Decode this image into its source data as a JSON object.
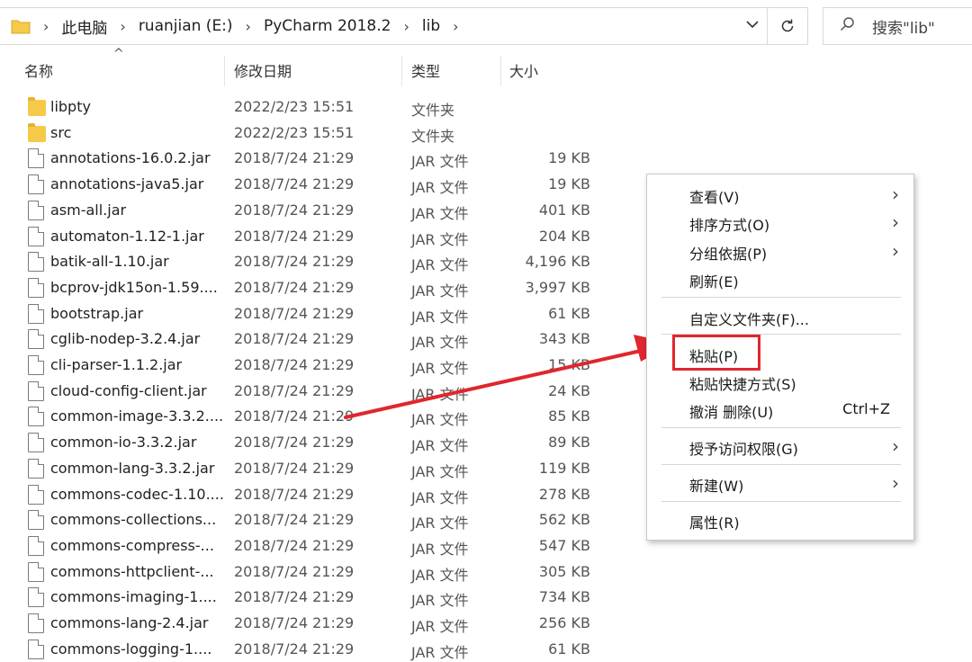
{
  "address": {
    "crumbs": [
      "此电脑",
      "ruanjian (E:)",
      "PyCharm 2018.2",
      "lib"
    ]
  },
  "search": {
    "placeholder": "搜索\"lib\""
  },
  "columns": {
    "name": "名称",
    "date": "修改日期",
    "type": "类型",
    "size": "大小"
  },
  "files": [
    {
      "name": "libpty",
      "date": "2022/2/23 15:51",
      "type": "文件夹",
      "size": "",
      "kind": "folder"
    },
    {
      "name": "src",
      "date": "2022/2/23 15:51",
      "type": "文件夹",
      "size": "",
      "kind": "folder"
    },
    {
      "name": "annotations-16.0.2.jar",
      "date": "2018/7/24 21:29",
      "type": "JAR 文件",
      "size": "19 KB",
      "kind": "file"
    },
    {
      "name": "annotations-java5.jar",
      "date": "2018/7/24 21:29",
      "type": "JAR 文件",
      "size": "19 KB",
      "kind": "file"
    },
    {
      "name": "asm-all.jar",
      "date": "2018/7/24 21:29",
      "type": "JAR 文件",
      "size": "401 KB",
      "kind": "file"
    },
    {
      "name": "automaton-1.12-1.jar",
      "date": "2018/7/24 21:29",
      "type": "JAR 文件",
      "size": "204 KB",
      "kind": "file"
    },
    {
      "name": "batik-all-1.10.jar",
      "date": "2018/7/24 21:29",
      "type": "JAR 文件",
      "size": "4,196 KB",
      "kind": "file"
    },
    {
      "name": "bcprov-jdk15on-1.59....",
      "date": "2018/7/24 21:29",
      "type": "JAR 文件",
      "size": "3,997 KB",
      "kind": "file"
    },
    {
      "name": "bootstrap.jar",
      "date": "2018/7/24 21:29",
      "type": "JAR 文件",
      "size": "61 KB",
      "kind": "file"
    },
    {
      "name": "cglib-nodep-3.2.4.jar",
      "date": "2018/7/24 21:29",
      "type": "JAR 文件",
      "size": "343 KB",
      "kind": "file"
    },
    {
      "name": "cli-parser-1.1.2.jar",
      "date": "2018/7/24 21:29",
      "type": "JAR 文件",
      "size": "15 KB",
      "kind": "file"
    },
    {
      "name": "cloud-config-client.jar",
      "date": "2018/7/24 21:29",
      "type": "JAR 文件",
      "size": "24 KB",
      "kind": "file"
    },
    {
      "name": "common-image-3.3.2....",
      "date": "2018/7/24 21:29",
      "type": "JAR 文件",
      "size": "85 KB",
      "kind": "file"
    },
    {
      "name": "common-io-3.3.2.jar",
      "date": "2018/7/24 21:29",
      "type": "JAR 文件",
      "size": "89 KB",
      "kind": "file"
    },
    {
      "name": "common-lang-3.3.2.jar",
      "date": "2018/7/24 21:29",
      "type": "JAR 文件",
      "size": "119 KB",
      "kind": "file"
    },
    {
      "name": "commons-codec-1.10....",
      "date": "2018/7/24 21:29",
      "type": "JAR 文件",
      "size": "278 KB",
      "kind": "file"
    },
    {
      "name": "commons-collections...",
      "date": "2018/7/24 21:29",
      "type": "JAR 文件",
      "size": "562 KB",
      "kind": "file"
    },
    {
      "name": "commons-compress-...",
      "date": "2018/7/24 21:29",
      "type": "JAR 文件",
      "size": "547 KB",
      "kind": "file"
    },
    {
      "name": "commons-httpclient-...",
      "date": "2018/7/24 21:29",
      "type": "JAR 文件",
      "size": "305 KB",
      "kind": "file"
    },
    {
      "name": "commons-imaging-1....",
      "date": "2018/7/24 21:29",
      "type": "JAR 文件",
      "size": "734 KB",
      "kind": "file"
    },
    {
      "name": "commons-lang-2.4.jar",
      "date": "2018/7/24 21:29",
      "type": "JAR 文件",
      "size": "256 KB",
      "kind": "file"
    },
    {
      "name": "commons-logging-1....",
      "date": "2018/7/24 21:29",
      "type": "JAR 文件",
      "size": "61 KB",
      "kind": "file"
    }
  ],
  "context_menu": {
    "view": "查看(V)",
    "sort": "排序方式(O)",
    "group": "分组依据(P)",
    "refresh": "刷新(E)",
    "customize": "自定义文件夹(F)...",
    "paste": "粘贴(P)",
    "paste_shortcut": "粘贴快捷方式(S)",
    "undo": "撤消 删除(U)",
    "undo_shortcut": "Ctrl+Z",
    "grant_access": "授予访问权限(G)",
    "new": "新建(W)",
    "properties": "属性(R)"
  },
  "colors": {
    "highlight": "#e0262e",
    "folder": "#f7c948"
  }
}
